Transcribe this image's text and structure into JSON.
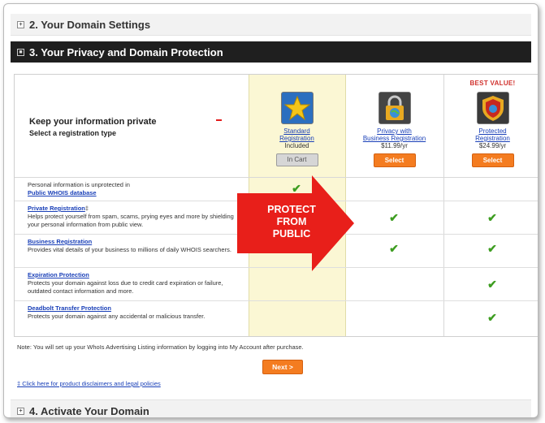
{
  "sections": {
    "s2": "2. Your Domain Settings",
    "s3": "3. Your Privacy and Domain Protection",
    "s4": "4. Activate Your Domain"
  },
  "intro": {
    "heading": "Keep your information private",
    "sub": "Select a registration type"
  },
  "packages": [
    {
      "badge": "",
      "name_line1": "Standard",
      "name_line2": "Registration",
      "price": "Included",
      "button": "In Cart",
      "icon": "star-icon"
    },
    {
      "badge": "",
      "name_line1": "Privacy with",
      "name_line2": "Business Registration",
      "price": "$11.99/yr",
      "button": "Select",
      "icon": "padlock-globe-icon"
    },
    {
      "badge": "BEST VALUE!",
      "name_line1": "Protected",
      "name_line2": "Registration",
      "price": "$24.99/yr",
      "button": "Select",
      "icon": "shield-icon"
    }
  ],
  "features": [
    {
      "pre": "Personal information is unprotected in",
      "link": "Public WHOIS database",
      "desc": ""
    },
    {
      "pre": "",
      "link": "Private Registration",
      "link_suffix": "‡",
      "desc": "Helps protect yourself from spam, scams, prying eyes and more by shielding your personal information from public view."
    },
    {
      "pre": "",
      "link": "Business Registration",
      "desc": "Provides vital details of your business to millions of daily WHOIS searchers."
    },
    {
      "pre": "",
      "link": "Expiration Protection",
      "desc": "Protects your domain against loss due to credit card expiration or failure, outdated contact information and more."
    },
    {
      "pre": "",
      "link": "Deadbolt Transfer Protection",
      "desc": "Protects your domain against any accidental or malicious transfer."
    }
  ],
  "note": "Note: You will set up your WhoIs Advertising Listing information by logging into My Account after purchase.",
  "next_label": "Next >",
  "disclaimer": "‡ Click here for product disclaimers and legal policies",
  "callout": {
    "line1": "PROTECT",
    "line2": "FROM",
    "line3": "PUBLIC"
  },
  "colors": {
    "accent_orange": "#f47c20",
    "check_green": "#3e9d21",
    "callout_red": "#e81f1a",
    "badge_red": "#d0312d"
  }
}
